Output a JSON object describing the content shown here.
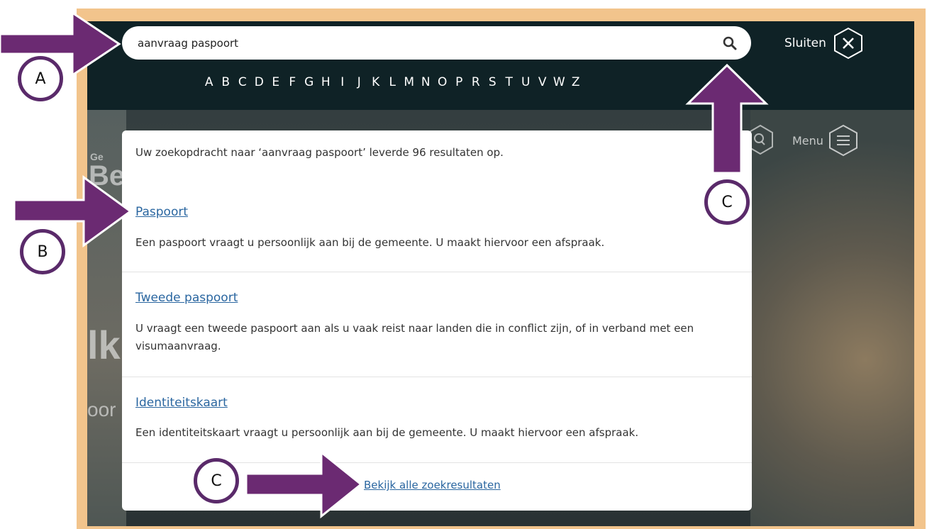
{
  "search": {
    "value": "aanvraag paspoort",
    "button_icon": "search-icon"
  },
  "alphabet": [
    "A",
    "B",
    "C",
    "D",
    "E",
    "F",
    "G",
    "H",
    "I",
    "J",
    "K",
    "L",
    "M",
    "N",
    "O",
    "P",
    "R",
    "S",
    "T",
    "U",
    "V",
    "W",
    "Z"
  ],
  "header": {
    "close_label": "Sluiten",
    "close_icon": "close-hex-icon",
    "menu_label": "Menu",
    "menu_icon": "menu-hex-icon"
  },
  "results": {
    "summary": "Uw zoekopdracht naar ‘aanvraag paspoort’ leverde 96 resultaten op.",
    "items": [
      {
        "title": "Paspoort",
        "description": "Een paspoort vraagt u persoonlijk aan bij de gemeente. U maakt hiervoor een afspraak."
      },
      {
        "title": "Tweede paspoort",
        "description": "U vraagt een tweede paspoort aan als u vaak reist naar landen die in conflict zijn, of in verband met een visumaanvraag."
      },
      {
        "title": "Identiteitskaart",
        "description": "Een identiteitskaart vraagt u persoonlijk aan bij de gemeente. U maakt hiervoor een afspraak."
      }
    ],
    "view_all": "Bekijk alle zoekresultaten"
  },
  "annotations": {
    "badge_a": "A",
    "badge_b": "B",
    "badge_c1": "C",
    "badge_c2": "C",
    "arrow_color": "#6b2a72",
    "frame_color": "#f2c48c"
  },
  "background": {
    "partial_text_1": "Ge",
    "partial_text_2": "Be",
    "partial_text_3": "lk",
    "partial_text_4": "oor"
  }
}
